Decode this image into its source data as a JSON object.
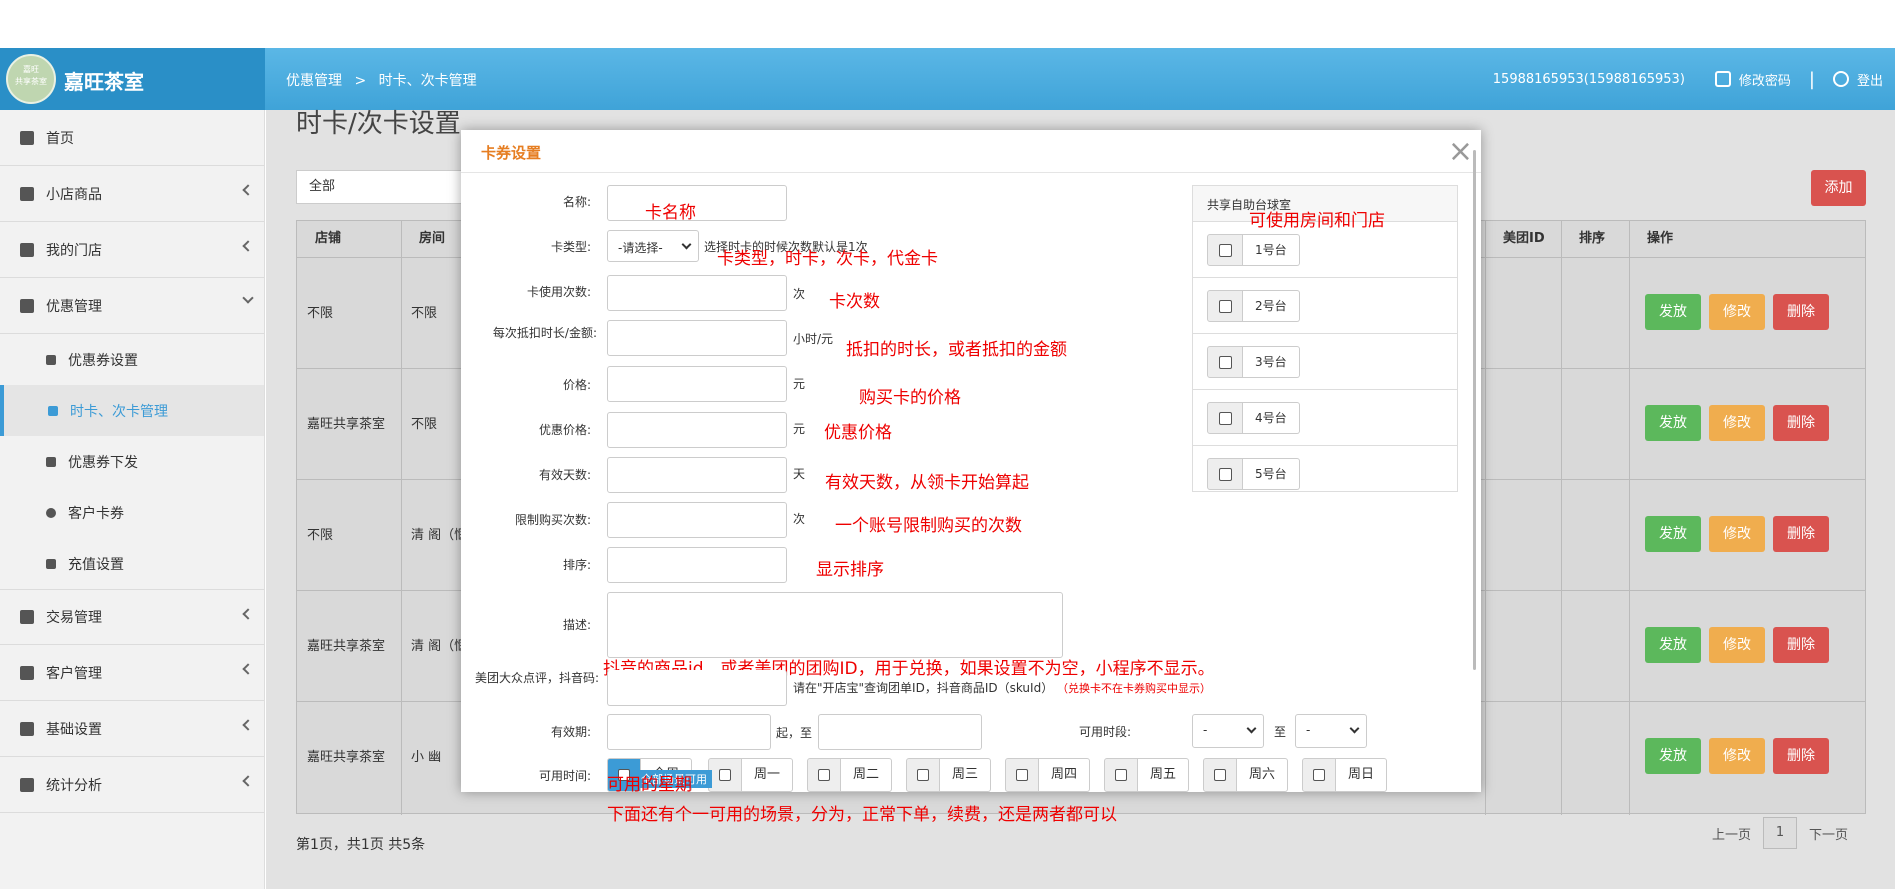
{
  "app": {
    "brand": "嘉旺茶室",
    "logo_text": "嘉旺\n共享茶室"
  },
  "header": {
    "breadcrumb": [
      "优惠管理",
      ">",
      "时卡、次卡管理"
    ],
    "user": "15988165953(15988165953)",
    "change_password": "修改密码",
    "separator": "|",
    "logout": "登出"
  },
  "sidebar": {
    "items": [
      {
        "label": "首页"
      },
      {
        "label": "小店商品"
      },
      {
        "label": "我的门店"
      },
      {
        "label": "优惠管理"
      },
      {
        "label": "优惠券设置"
      },
      {
        "label": "时卡、次卡管理"
      },
      {
        "label": "优惠券下发"
      },
      {
        "label": "客户卡券"
      },
      {
        "label": "充值设置"
      },
      {
        "label": "交易管理"
      },
      {
        "label": "客户管理"
      },
      {
        "label": "基础设置"
      },
      {
        "label": "统计分析"
      }
    ]
  },
  "page": {
    "title": "时卡/次卡设置",
    "filter_value": "全部",
    "add_label": "添加",
    "columns": [
      "店铺",
      "房间",
      "美团ID",
      "排序",
      "操作"
    ],
    "rows": [
      {
        "store": "不限",
        "room": "不限"
      },
      {
        "store": "嘉旺共享茶室",
        "room": "不限"
      },
      {
        "store": "不限",
        "room": "清 阁（惬"
      },
      {
        "store": "嘉旺共享茶室",
        "room": "清 阁（惬"
      },
      {
        "store": "嘉旺共享茶室",
        "room": "小 幽"
      }
    ],
    "actions": {
      "issue": "发放",
      "edit": "修改",
      "delete": "删除"
    },
    "pager_text": "第1页，共1页 共5条",
    "pager": {
      "prev": "上一页",
      "current": "1",
      "next": "下一页"
    }
  },
  "modal": {
    "title": "卡券设置",
    "close": "×",
    "fields": {
      "name": "名称:",
      "card_type": "卡类型:",
      "card_type_value": "-请选择-",
      "card_type_hint": "选择时卡的时候次数默认是1次",
      "use_count": "卡使用次数:",
      "use_count_unit": "次",
      "deduct": "每次抵扣时长/金额:",
      "deduct_unit": "小时/元",
      "price": "价格:",
      "price_unit": "元",
      "discount_price": "优惠价格:",
      "discount_unit": "元",
      "valid_days": "有效天数:",
      "valid_days_unit": "天",
      "limit": "限制购买次数:",
      "limit_unit": "次",
      "sort": "排序:",
      "desc": "描述:",
      "meituan": "美团大众点评，抖音码:",
      "meituan_hint": "请在\"开店宝\"查询团单ID，抖音商品ID（skuId）",
      "meituan_hint_red": "（兑换卡不在卡券购买中显示）",
      "validity": "有效期:",
      "from": "起，至",
      "time_range": "可用时段:",
      "time_from": "-",
      "to": "至",
      "time_to": "-",
      "weekdays_label": "可用时间:",
      "weekdays": [
        "全周",
        "周一",
        "周二",
        "周三",
        "周四",
        "周五",
        "周六",
        "周日"
      ],
      "scene_badge": "全部场景可用"
    },
    "shared_table": {
      "header": "共享自助台球室",
      "tables": [
        "1号台",
        "2号台",
        "3号台",
        "4号台",
        "5号台"
      ]
    },
    "annotations": {
      "name": "卡名称",
      "type": "卡类型，时卡，次卡，代金卡",
      "count": "卡次数",
      "deduct": "抵扣的时长，或者抵扣的金额",
      "price": "购买卡的价格",
      "discount": "优惠价格",
      "days": "有效天数，从领卡开始算起",
      "limit": "一个账号限制购买的次数",
      "sort": "显示排序",
      "rooms": "可使用房间和门店",
      "meituan": "抖音的商品id，或者美团的团购ID，用于兑换，如果设置不为空，小程序不显示。",
      "weekday": "可用的星期",
      "scene": "下面还有个一可用的场景，分为，正常下单，续费，还是两者都可以"
    }
  }
}
